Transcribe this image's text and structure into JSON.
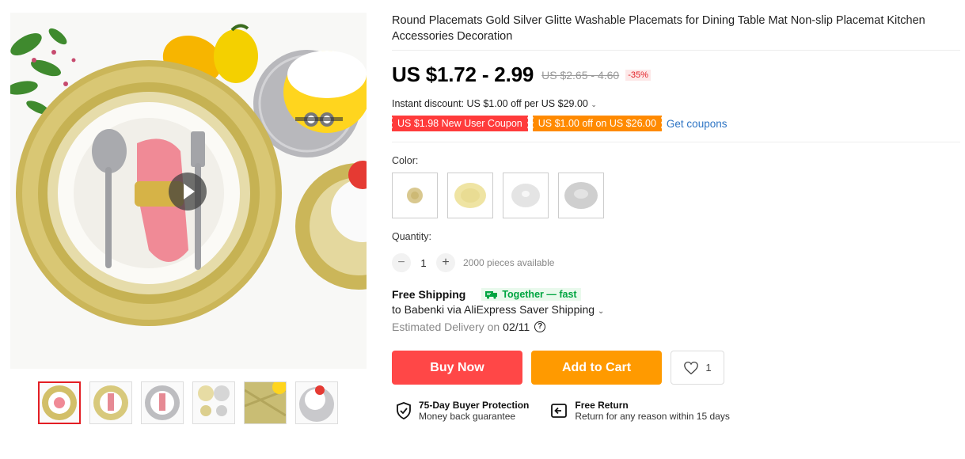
{
  "product": {
    "title": "Round Placemats Gold Silver Glitte Washable Placemats for Dining Table Mat Non-slip Placemat Kitchen Accessories Decoration"
  },
  "pricing": {
    "price": "US $1.72 - 2.99",
    "original_price": "US $2.65 - 4.60",
    "discount": "-35%",
    "instant_discount": "Instant discount: US $1.00 off per US $29.00",
    "coupons": [
      "US $1.98 New User Coupon",
      "US $1.00 off on US $26.00"
    ],
    "get_coupons": "Get coupons"
  },
  "color": {
    "label": "Color:",
    "options": [
      {
        "name": "gold-small",
        "fill": "#d9c88f"
      },
      {
        "name": "gold",
        "fill": "#efe4a3"
      },
      {
        "name": "silver-light",
        "fill": "#e2e2e2"
      },
      {
        "name": "silver",
        "fill": "#cfcfcf"
      }
    ]
  },
  "quantity": {
    "label": "Quantity:",
    "minus": "−",
    "value": "1",
    "plus": "+",
    "available": "2000 pieces available"
  },
  "shipping": {
    "title": "Free Shipping",
    "tag": "Together — fast",
    "to": "to Babenki via AliExpress Saver Shipping",
    "eta_label": "Estimated Delivery on",
    "eta_date": "02/11",
    "help": "?"
  },
  "actions": {
    "buy_now": "Buy Now",
    "add_to_cart": "Add to Cart",
    "wishlist_count": "1"
  },
  "guarantees": [
    {
      "title": "75-Day Buyer Protection",
      "subtitle": "Money back guarantee",
      "icon": "shield-check-icon"
    },
    {
      "title": "Free Return",
      "subtitle": "Return for any reason within 15 days",
      "icon": "return-icon"
    }
  ],
  "colors": {
    "buy": "#ff4747",
    "cart": "#ff9a00",
    "accent_red": "#e31e24",
    "link": "#2d74c4",
    "green": "#00a541"
  }
}
